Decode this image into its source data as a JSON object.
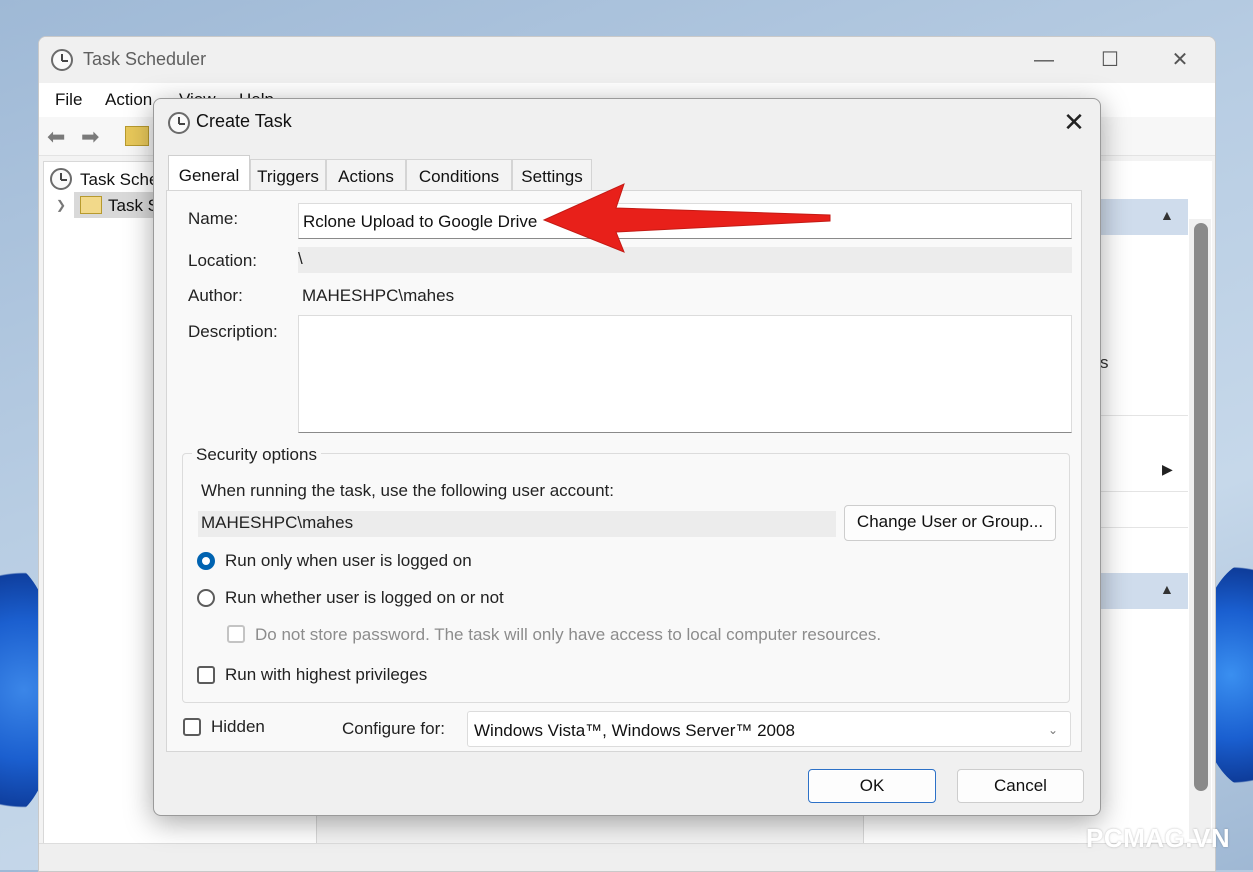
{
  "main_window": {
    "title": "Task Scheduler",
    "window_controls": {
      "minimize": "—",
      "maximize": "☐",
      "close": "✕"
    },
    "menu": [
      "File",
      "Action",
      "View",
      "Help"
    ],
    "tree": {
      "root": "Task Sche",
      "child": "Task S"
    },
    "right_pane_partial_text": "s"
  },
  "dialog": {
    "title": "Create Task",
    "close_glyph": "✕",
    "tabs": [
      "General",
      "Triggers",
      "Actions",
      "Conditions",
      "Settings"
    ],
    "active_tab": "General",
    "general": {
      "name_label": "Name:",
      "name_value": "Rclone Upload to Google Drive",
      "location_label": "Location:",
      "location_value": "\\",
      "author_label": "Author:",
      "author_value": "MAHESHPC\\mahes",
      "description_label": "Description:",
      "description_value": ""
    },
    "security": {
      "group_label": "Security options",
      "account_prompt": "When running the task, use the following user account:",
      "account_value": "MAHESHPC\\mahes",
      "change_button": "Change User or Group...",
      "radio_logged_on": "Run only when user is logged on",
      "radio_logged_on_selected": true,
      "radio_whether": "Run whether user is logged on or not",
      "radio_whether_selected": false,
      "do_not_store": "Do not store password.  The task will only have access to local computer resources.",
      "highest_privileges": "Run with highest privileges"
    },
    "hidden_label": "Hidden",
    "configure_label": "Configure for:",
    "configure_value": "Windows Vista™, Windows Server™ 2008",
    "ok_button": "OK",
    "cancel_button": "Cancel"
  },
  "annotation": {
    "arrow_color": "#e8201a"
  },
  "watermark": "PCMAG.VN",
  "colors": {
    "accent": "#0063b1",
    "action_band": "#cfdcec"
  }
}
